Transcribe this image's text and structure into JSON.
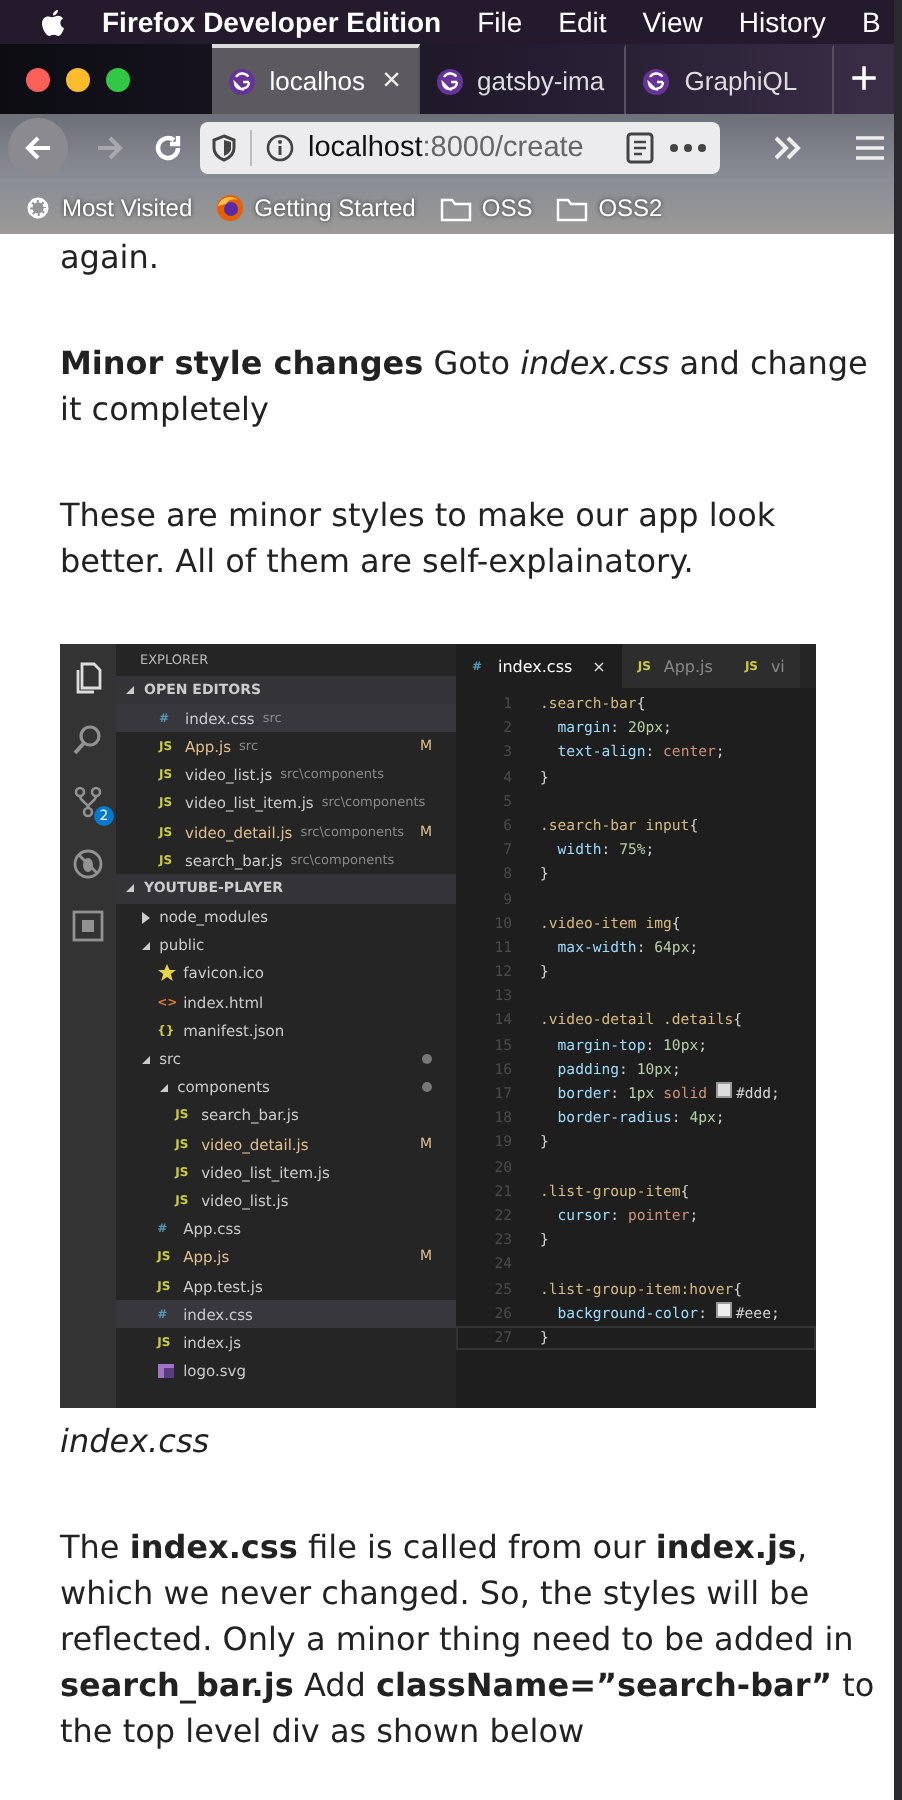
{
  "menubar": {
    "app": "Firefox Developer Edition",
    "items": [
      "File",
      "Edit",
      "View",
      "History",
      "B"
    ]
  },
  "tabs": [
    {
      "title": "localhos",
      "selected": true,
      "close": "×"
    },
    {
      "title": "gatsby-ima",
      "selected": false
    },
    {
      "title": "GraphiQL",
      "selected": false
    }
  ],
  "new_tab": "+",
  "navbar": {
    "back_enabled": true,
    "forward_enabled": false,
    "url_host": "localhost",
    "url_rest": ":8000/create"
  },
  "bookmarks": [
    {
      "label": "Most Visited",
      "kind": "gear"
    },
    {
      "label": "Getting Started",
      "kind": "browser"
    },
    {
      "label": "OSS",
      "kind": "folder"
    },
    {
      "label": "OSS2",
      "kind": "folder"
    }
  ],
  "article": {
    "before": [
      "again.",
      "**Minor style changes** Goto *index.css* and change it completely",
      "These are minor styles to make our app look better. All of them are self-explainatory."
    ],
    "figure": {
      "activity": [
        {
          "kind": "files",
          "selected": true
        },
        {
          "kind": "search",
          "selected": false
        },
        {
          "kind": "git",
          "selected": false,
          "badge": "2"
        },
        {
          "kind": "debug",
          "selected": false
        },
        {
          "kind": "extensions",
          "selected": false
        }
      ],
      "explorer_title": "EXPLORER",
      "open_editors": {
        "title": "OPEN EDITORS",
        "expanded": true,
        "items": [
          {
            "name": "index.css",
            "detail": "src",
            "kind": "css",
            "glyph": "#",
            "selected": true
          },
          {
            "name": "App.js",
            "detail": "src",
            "kind": "js",
            "glyph": "JS",
            "status": "M",
            "selected": false
          },
          {
            "name": "video_list.js",
            "detail": "src\\components",
            "kind": "js",
            "glyph": "JS",
            "selected": false
          },
          {
            "name": "video_list_item.js",
            "detail": "src\\components",
            "kind": "js",
            "glyph": "JS",
            "selected": false
          },
          {
            "name": "video_detail.js",
            "detail": "src\\components",
            "kind": "js",
            "glyph": "JS",
            "status": "M",
            "selected": false
          },
          {
            "name": "search_bar.js",
            "detail": "src\\components",
            "kind": "js",
            "glyph": "JS",
            "selected": false
          }
        ]
      },
      "project": {
        "title": "YOUTUBE-PLAYER",
        "expanded": true,
        "children": [
          {
            "name": "node_modules",
            "kind": "folder",
            "expanded": false,
            "changed": false,
            "selected": false
          },
          {
            "name": "public",
            "kind": "folder",
            "expanded": true,
            "changed": false,
            "selected": false,
            "children": [
              {
                "name": "favicon.ico",
                "kind": "favicon",
                "selected": false
              },
              {
                "name": "index.html",
                "kind": "html",
                "glyph": "<>",
                "selected": false
              },
              {
                "name": "manifest.json",
                "kind": "json",
                "glyph": "{}",
                "selected": false
              }
            ]
          },
          {
            "name": "src",
            "kind": "folder",
            "expanded": true,
            "changed": true,
            "selected": false,
            "children": [
              {
                "name": "components",
                "kind": "folder",
                "expanded": true,
                "changed": true,
                "selected": false,
                "children": [
                  {
                    "name": "search_bar.js",
                    "kind": "js",
                    "glyph": "JS",
                    "selected": false
                  },
                  {
                    "name": "video_detail.js",
                    "kind": "js",
                    "glyph": "JS",
                    "status": "M",
                    "selected": false
                  },
                  {
                    "name": "video_list_item.js",
                    "kind": "js",
                    "glyph": "JS",
                    "selected": false
                  },
                  {
                    "name": "video_list.js",
                    "kind": "js",
                    "glyph": "JS",
                    "selected": false
                  }
                ]
              },
              {
                "name": "App.css",
                "kind": "css",
                "glyph": "#",
                "selected": false
              },
              {
                "name": "App.js",
                "kind": "js",
                "glyph": "JS",
                "status": "M",
                "selected": false
              },
              {
                "name": "App.test.js",
                "kind": "js",
                "glyph": "JS",
                "selected": false
              },
              {
                "name": "index.css",
                "kind": "css",
                "glyph": "#",
                "selected": true
              },
              {
                "name": "index.js",
                "kind": "js",
                "glyph": "JS",
                "selected": false
              },
              {
                "name": "logo.svg",
                "kind": "image",
                "selected": false
              }
            ]
          }
        ]
      },
      "editor_tabs": [
        {
          "label": "index.css",
          "kind": "css",
          "glyph": "#",
          "selected": true,
          "close": "×"
        },
        {
          "label": "App.js",
          "kind": "js",
          "glyph": "JS",
          "selected": false
        },
        {
          "label": "vi",
          "kind": "js",
          "glyph": "JS",
          "selected": false
        }
      ],
      "lines": [
        {
          "number": "1",
          "code": ".search-bar{",
          "active": false
        },
        {
          "number": "2",
          "code": "  margin: 20px;",
          "active": false
        },
        {
          "number": "3",
          "code": "  text-align: center;",
          "active": false
        },
        {
          "number": "4",
          "code": "}",
          "active": false
        },
        {
          "number": "5",
          "active": false
        },
        {
          "number": "6",
          "code": ".search-bar input{",
          "active": false
        },
        {
          "number": "7",
          "code": "  width: 75%;",
          "active": false
        },
        {
          "number": "8",
          "code": "}",
          "active": false
        },
        {
          "number": "9",
          "active": false
        },
        {
          "number": "10",
          "code": ".video-item img{",
          "active": false
        },
        {
          "number": "11",
          "code": "  max-width: 64px;",
          "active": false
        },
        {
          "number": "12",
          "code": "}",
          "active": false
        },
        {
          "number": "13",
          "active": false
        },
        {
          "number": "14",
          "code": ".video-detail .details{",
          "active": false
        },
        {
          "number": "15",
          "code": "  margin-top: 10px;",
          "active": false
        },
        {
          "number": "16",
          "code": "  padding: 10px;",
          "active": false
        },
        {
          "number": "17",
          "code": "  border: 1px solid ",
          "color": "#dddddd",
          "code_after": "#ddd;",
          "active": false
        },
        {
          "number": "18",
          "code": "  border-radius: 4px;",
          "active": false
        },
        {
          "number": "19",
          "code": "}",
          "active": false
        },
        {
          "number": "20",
          "active": false
        },
        {
          "number": "21",
          "code": ".list-group-item{",
          "active": false
        },
        {
          "number": "22",
          "code": "  cursor: pointer;",
          "active": false
        },
        {
          "number": "23",
          "code": "}",
          "active": false
        },
        {
          "number": "24",
          "active": false
        },
        {
          "number": "25",
          "code": ".list-group-item:hover{",
          "active": false
        },
        {
          "number": "26",
          "code": "  background-color: ",
          "color": "#eeeeee",
          "code_after": "#eee;",
          "active": false
        },
        {
          "number": "27",
          "code": "}",
          "active": true
        }
      ]
    },
    "caption": "index.css",
    "after": [
      "The **index.css** file is called from our **index.js**, which we never changed. So, the styles will be reflected. Only a minor thing need to be added in **search_bar.js** Add **className=”search-bar”** to the top level div as shown below"
    ]
  }
}
